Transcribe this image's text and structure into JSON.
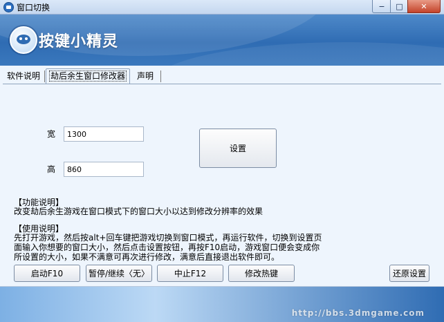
{
  "window": {
    "title": "窗口切换"
  },
  "banner": {
    "logo_text": "按键小精灵"
  },
  "tabs": [
    {
      "label": "软件说明"
    },
    {
      "label": "劫后余生窗口修改器"
    },
    {
      "label": "声明"
    }
  ],
  "form": {
    "width_label": "宽",
    "width_value": "1300",
    "height_label": "高",
    "height_value": "860",
    "set_button": "设置"
  },
  "help": {
    "feature_title": "【功能说明】",
    "feature_text": "改变劫后余生游戏在窗口模式下的窗口大小以达到修改分辨率的效果",
    "usage_title": "【使用说明】",
    "usage_lines": [
      "先打开游戏，然后按alt+回车键把游戏切换到窗口模式，再运行软件，切换到设置页",
      "面输入你想要的窗口大小，然后点击设置按钮，再按F10启动，游戏窗口便会变成你",
      "所设置的大小，如果不满意可再次进行修改，满意后直接退出软件即可。"
    ]
  },
  "buttons": {
    "start": "启动F10",
    "pause": "暂停/继续〈无〉",
    "stop": "中止F12",
    "hotkey": "修改热键",
    "restore": "还原设置"
  },
  "footer": {
    "watermark": "http://bbs.3dmgame.com"
  }
}
